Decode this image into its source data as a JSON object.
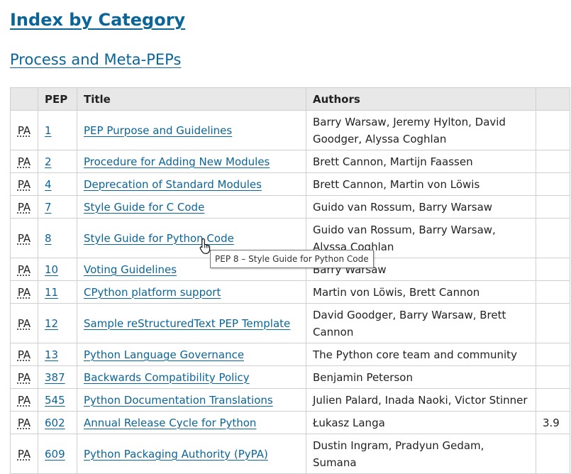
{
  "page": {
    "title": "Index by Category",
    "section_heading": "Process and Meta-PEPs"
  },
  "table": {
    "headers": [
      "",
      "PEP",
      "Title",
      "Authors",
      ""
    ],
    "rows": [
      {
        "type": "PA",
        "pep": "1",
        "title": "PEP Purpose and Guidelines",
        "authors": "Barry Warsaw, Jeremy Hylton, David Goodger, Alyssa Coghlan",
        "version": ""
      },
      {
        "type": "PA",
        "pep": "2",
        "title": "Procedure for Adding New Modules",
        "authors": "Brett Cannon, Martijn Faassen",
        "version": ""
      },
      {
        "type": "PA",
        "pep": "4",
        "title": "Deprecation of Standard Modules",
        "authors": "Brett Cannon, Martin von Löwis",
        "version": ""
      },
      {
        "type": "PA",
        "pep": "7",
        "title": "Style Guide for C Code",
        "authors": "Guido van Rossum, Barry Warsaw",
        "version": ""
      },
      {
        "type": "PA",
        "pep": "8",
        "title": "Style Guide for Python Code",
        "authors": "Guido van Rossum, Barry Warsaw, Alyssa Coghlan",
        "version": ""
      },
      {
        "type": "PA",
        "pep": "10",
        "title": "Voting Guidelines",
        "authors": "Barry Warsaw",
        "version": ""
      },
      {
        "type": "PA",
        "pep": "11",
        "title": "CPython platform support",
        "authors": "Martin von Löwis, Brett Cannon",
        "version": ""
      },
      {
        "type": "PA",
        "pep": "12",
        "title": "Sample reStructuredText PEP Template",
        "authors": "David Goodger, Barry Warsaw, Brett Cannon",
        "version": ""
      },
      {
        "type": "PA",
        "pep": "13",
        "title": "Python Language Governance",
        "authors": "The Python core team and community",
        "version": ""
      },
      {
        "type": "PA",
        "pep": "387",
        "title": "Backwards Compatibility Policy",
        "authors": "Benjamin Peterson",
        "version": ""
      },
      {
        "type": "PA",
        "pep": "545",
        "title": "Python Documentation Translations",
        "authors": "Julien Palard, Inada Naoki, Victor Stinner",
        "version": ""
      },
      {
        "type": "PA",
        "pep": "602",
        "title": "Annual Release Cycle for Python",
        "authors": "Łukasz Langa",
        "version": "3.9"
      },
      {
        "type": "PA",
        "pep": "609",
        "title": "Python Packaging Authority (PyPA)",
        "authors": "Dustin Ingram, Pradyun Gedam, Sumana",
        "version": ""
      }
    ]
  },
  "tooltip": {
    "text": "PEP 8 – Style Guide for Python Code"
  },
  "cursor": {
    "icon": "hand-pointer-icon"
  },
  "colors": {
    "link": "#0b6598",
    "header_bg": "#e8e8e8",
    "border": "#cfcfcf"
  }
}
